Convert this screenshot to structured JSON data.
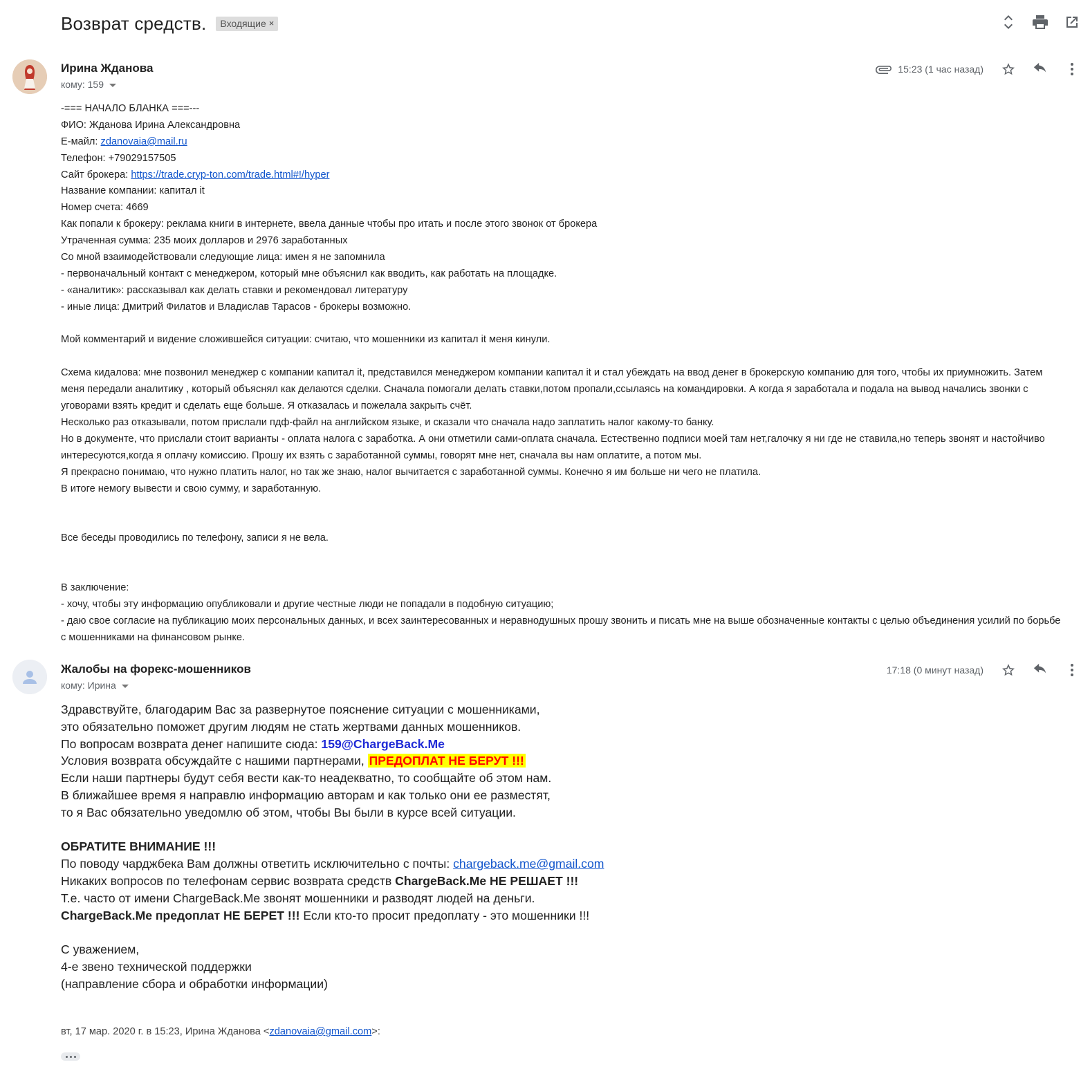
{
  "thread": {
    "subject": "Возврат средств.",
    "label": "Входящие",
    "label_remove": "×"
  },
  "message1": {
    "sender": "Ирина Жданова",
    "to": "кому: 159",
    "time": "15:23 (1 час назад)",
    "lines": {
      "l01": "-=== НАЧАЛО БЛАНКА ===---",
      "l02": "ФИО: Жданова Ирина Александровна",
      "l03_prefix": "Е-майл: ",
      "l03_link": "zdanovaia@mail.ru",
      "l04": "Телефон: +79029157505",
      "l05_prefix": "Сайт брокера: ",
      "l05_link": "https://trade.cryp-ton.com/trade.html#!/hyper",
      "l06": "Название компании: капитал it",
      "l07": "Номер счета: 4669",
      "l08": "Как попали к брокеру: реклама книги в интернете, ввела данные чтобы про итать и после этого звонок от брокера",
      "l09": "Утраченная сумма: 235 моих долларов и 2976 заработанных",
      "l10": "Со мной взаимодействовали следующие лица: имен я не запомнила",
      "l11": "- первоначальный контакт с менеджером, который мне объяснил как вводить, как работать на площадке.",
      "l12": "- «аналитик»: рассказывал как делать ставки и рекомендовал литературу",
      "l13": "- иные лица: Дмитрий Филатов и Владислав Тарасов - брокеры возможно.",
      "l14": "Мой комментарий и видение сложившейся ситуации: считаю, что мошенники из капитал it меня кинули.",
      "p1": "Схема кидалова: мне позвонил менеджер с компании капитал it, представился менеджером компании капитал it и стал убеждать на ввод денег в брокерскую компанию для того, чтобы их приумножить. Затем меня передали аналитику , который объяснял как делаются сделки. Сначала помогали делать ставки,потом пропали,ссылаясь на командировки. А когда я заработала и подала на вывод начались звонки с уговорами взять кредит и сделать еще больше. Я отказалась и пожелала закрыть счёт.",
      "p2": "Несколько раз отказывали, потом прислали пдф-файл на английском языке, и сказали что сначала надо заплатить налог какому-то банку.",
      "p3": "Но в документе, что прислали стоит варианты - оплата налога с заработка. А они отметили сами-оплата сначала. Естественно подписи моей там нет,галочку я ни где не ставила,но теперь звонят и настойчиво интересуются,когда я оплачу комиссию. Прошу их взять с заработанной суммы, говорят мне нет, сначала вы нам оплатите, а потом мы.",
      "p4": "Я прекрасно понимаю, что нужно платить налог, но так же знаю, налог вычитается с заработанной суммы. Конечно я им больше ни чего не платила.",
      "p5": "В итоге немогу вывести и свою сумму, и заработанную.",
      "p6": "Все беседы проводились по телефону, записи я не вела.",
      "p7": "В заключение:",
      "p8": "- хочу, чтобы эту информацию опубликовали и другие честные люди не попадали в подобную ситуацию;",
      "p9": "- даю свое согласие на публикацию моих персональных данных, и всех заинтересованных и неравнодушных прошу звонить и писать мне на выше обозначенные контакты с целью объединения усилий по борьбе с мошенниками на финансовом рынке."
    }
  },
  "message2": {
    "sender": "Жалобы на форекс-мошенников",
    "to": "кому: Ирина",
    "time": "17:18 (0 минут назад)",
    "lines": {
      "m01": "Здравствуйте, благодарим Вас за развернутое пояснение ситуации с мошенниками,",
      "m02": "это обязательно поможет другим людям не стать жертвами данных мошенников.",
      "m03_prefix": "По вопросам возврата денег напишите сюда: ",
      "m03_email": "159@ChargeBack.Me",
      "m04_prefix": "Условия возврата обсуждайте с нашими партнерами, ",
      "m04_warn": "ПРЕДОПЛАТ НЕ БЕРУТ !!!",
      "m05": "Если наши партнеры будут себя вести как-то неадекватно, то сообщайте об этом нам.",
      "m06": "В ближайшее время я направлю информацию авторам и как только они ее разместят,",
      "m07": "то я Вас обязательно уведомлю об этом, чтобы Вы были в курсе всей ситуации.",
      "m08": "ОБРАТИТЕ ВНИМАНИЕ !!!",
      "m09_prefix": "По поводу чарджбека Вам должны ответить исключительно с почты: ",
      "m09_link": "chargeback.me@gmail.com",
      "m10_prefix": "Никаких вопросов по телефонам сервис возврата средств ",
      "m10_bold": "ChargeBack.Me НЕ РЕШАЕТ !!!",
      "m11": "Т.е. часто от имени ChargeBack.Me звонят мошенники и разводят людей на деньги.",
      "m12_bold": "ChargeBack.Me предоплат НЕ БЕРЕТ !!!",
      "m12_suffix": " Если кто-то просит предоплату - это мошенники !!!",
      "m13": "С уважением,",
      "m14": "4-е звено технической поддержки",
      "m15": "(направление сбора и обработки информации)"
    },
    "quote_prefix": "вт, 17 мар. 2020 г. в 15:23, Ирина Жданова <",
    "quote_link": "zdanovaia@gmail.com",
    "quote_suffix": ">:"
  },
  "icons": {
    "top": [
      "expand-collapse-icon",
      "print-icon",
      "open-new-window-icon"
    ],
    "message": [
      "attachment-icon",
      "star-icon",
      "reply-icon",
      "more-vert-icon"
    ]
  },
  "colors": {
    "link": "#1155cc",
    "email_highlight": "#1f2ad6",
    "warning_text": "#ff0000",
    "warning_bg": "#ffff00"
  }
}
